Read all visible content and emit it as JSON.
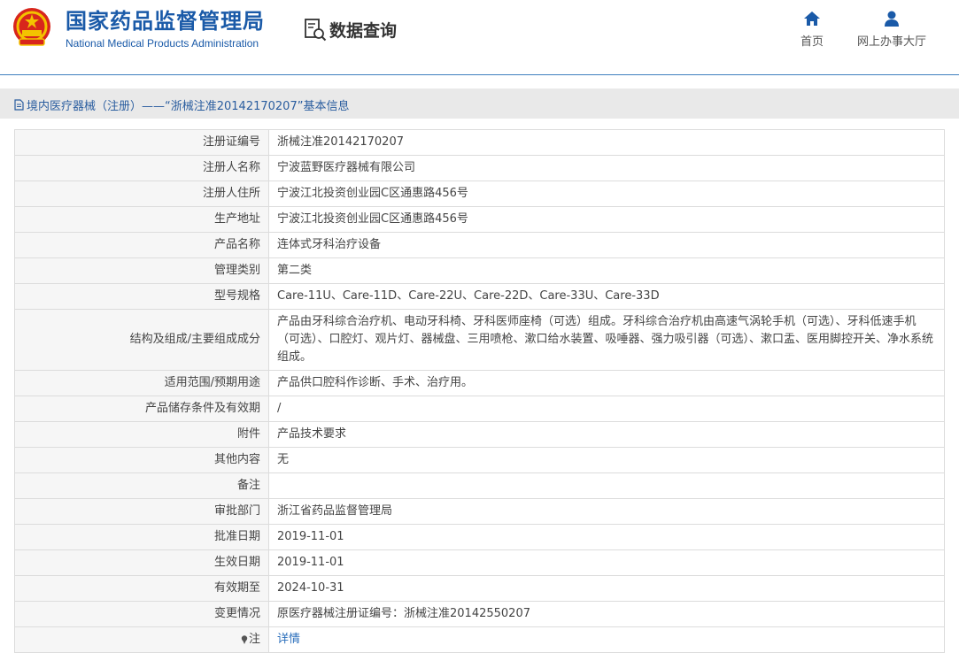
{
  "header": {
    "org_name_cn": "国家药品监督管理局",
    "org_name_en": "National Medical Products Administration",
    "query_label": "数据查询",
    "nav": [
      {
        "label": "首页",
        "icon": "home-icon"
      },
      {
        "label": "网上办事大厅",
        "icon": "user-icon"
      }
    ]
  },
  "section": {
    "title": "境内医疗器械（注册）——“浙械注准20142170207”基本信息",
    "icon": "document-icon"
  },
  "rows": [
    {
      "label": "注册证编号",
      "value": "浙械注准20142170207"
    },
    {
      "label": "注册人名称",
      "value": "宁波蓝野医疗器械有限公司"
    },
    {
      "label": "注册人住所",
      "value": "宁波江北投资创业园C区通惠路456号"
    },
    {
      "label": "生产地址",
      "value": "宁波江北投资创业园C区通惠路456号"
    },
    {
      "label": "产品名称",
      "value": "连体式牙科治疗设备"
    },
    {
      "label": "管理类别",
      "value": "第二类"
    },
    {
      "label": "型号规格",
      "value": "Care-11U、Care-11D、Care-22U、Care-22D、Care-33U、Care-33D"
    },
    {
      "label": "结构及组成/主要组成成分",
      "value": "产品由牙科综合治疗机、电动牙科椅、牙科医师座椅（可选）组成。牙科综合治疗机由高速气涡轮手机（可选）、牙科低速手机（可选）、口腔灯、观片灯、器械盘、三用喷枪、漱口给水装置、吸唾器、强力吸引器（可选）、漱口盂、医用脚控开关、净水系统组成。"
    },
    {
      "label": "适用范围/预期用途",
      "value": "产品供口腔科作诊断、手术、治疗用。"
    },
    {
      "label": "产品储存条件及有效期",
      "value": "/"
    },
    {
      "label": "附件",
      "value": "产品技术要求"
    },
    {
      "label": "其他内容",
      "value": "无"
    },
    {
      "label": "备注",
      "value": ""
    },
    {
      "label": "审批部门",
      "value": "浙江省药品监督管理局"
    },
    {
      "label": "批准日期",
      "value": "2019-11-01"
    },
    {
      "label": "生效日期",
      "value": "2019-11-01"
    },
    {
      "label": "有效期至",
      "value": "2024-10-31"
    },
    {
      "label": "变更情况",
      "value": "原医疗器械注册证编号：浙械注准20142550207"
    }
  ],
  "note_row": {
    "label": "注",
    "link": "详情",
    "icon": "pin-icon"
  },
  "colors": {
    "brand": "#1a5aa8",
    "link": "#2a6ebb",
    "band": "#e9e9e9",
    "label_bg": "#f6f6f6"
  }
}
